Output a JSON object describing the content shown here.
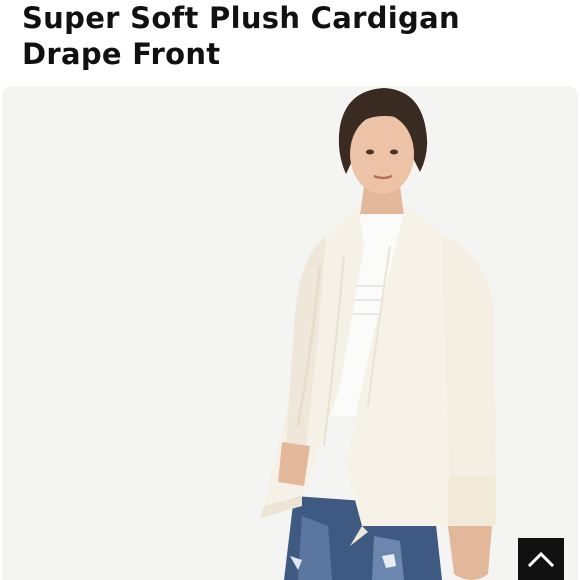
{
  "product": {
    "title": "Super Soft Plush Cardigan Drape Front"
  },
  "photo": {
    "icon": "product-photo",
    "background_color": "#f4f4f2",
    "garment_color": "#f6f1e6"
  },
  "scroll_top_button": {
    "icon": "chevron-up-icon",
    "background_color": "#111111"
  }
}
